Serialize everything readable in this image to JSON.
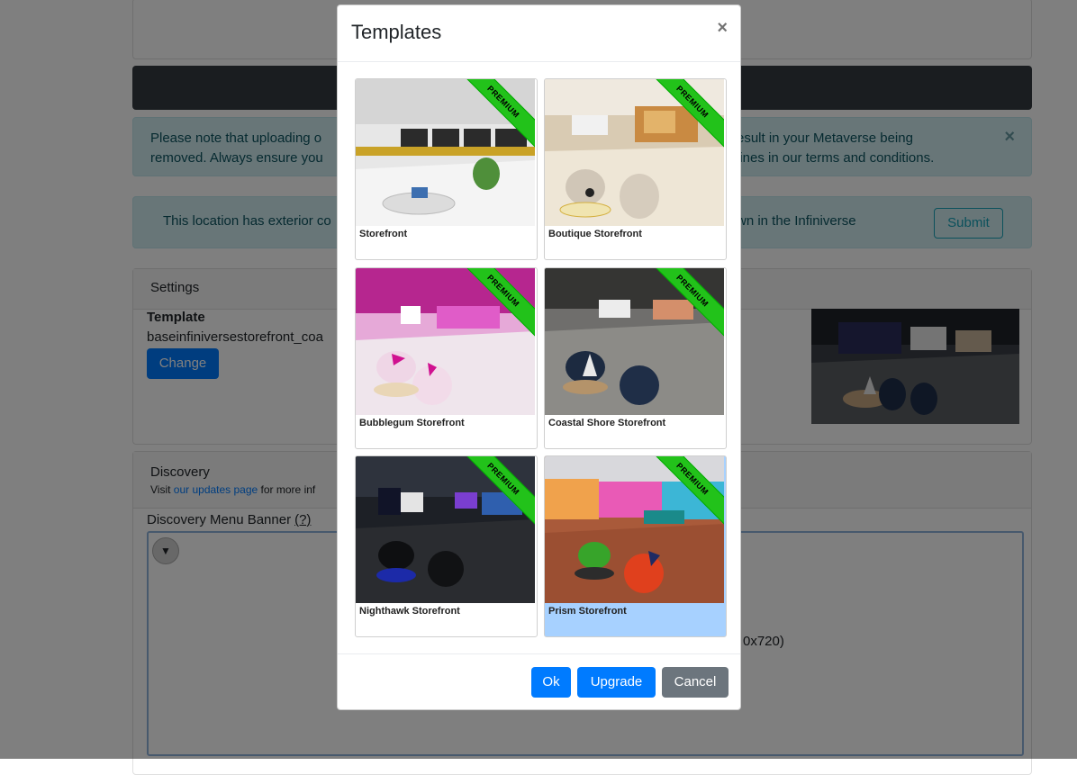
{
  "page": {
    "alert1": {
      "text_left": "Please note that uploading o\nremoved. Always ensure you",
      "text_right": "esult in your Metaverse being\nlines in our terms and conditions.",
      "close": "×"
    },
    "alert2": {
      "text_left": "This location has exterior co",
      "text_right": "wn in the Infiniverse",
      "submit": "Submit"
    },
    "settings": {
      "header": "Settings",
      "template_label": "Template",
      "template_value": "baseinfiniversestorefront_coa",
      "change": "Change"
    },
    "discovery": {
      "header": "Discovery",
      "sub_prefix": "Visit ",
      "sub_link": "our updates page",
      "sub_suffix": " for more inf",
      "banner_label": "Discovery Menu Banner",
      "banner_help": "(?)",
      "dimensions": "0x720)"
    }
  },
  "modal": {
    "title": "Templates",
    "close": "×",
    "premium": "PREMIUM",
    "templates": [
      {
        "name": "Storefront",
        "premium": true
      },
      {
        "name": "Boutique Storefront",
        "premium": true
      },
      {
        "name": "Bubblegum Storefront",
        "premium": true
      },
      {
        "name": "Coastal Shore Storefront",
        "premium": true
      },
      {
        "name": "Nighthawk Storefront",
        "premium": true
      },
      {
        "name": "Prism Storefront",
        "premium": true,
        "selected": true
      }
    ],
    "buttons": {
      "ok": "Ok",
      "upgrade": "Upgrade",
      "cancel": "Cancel"
    }
  }
}
